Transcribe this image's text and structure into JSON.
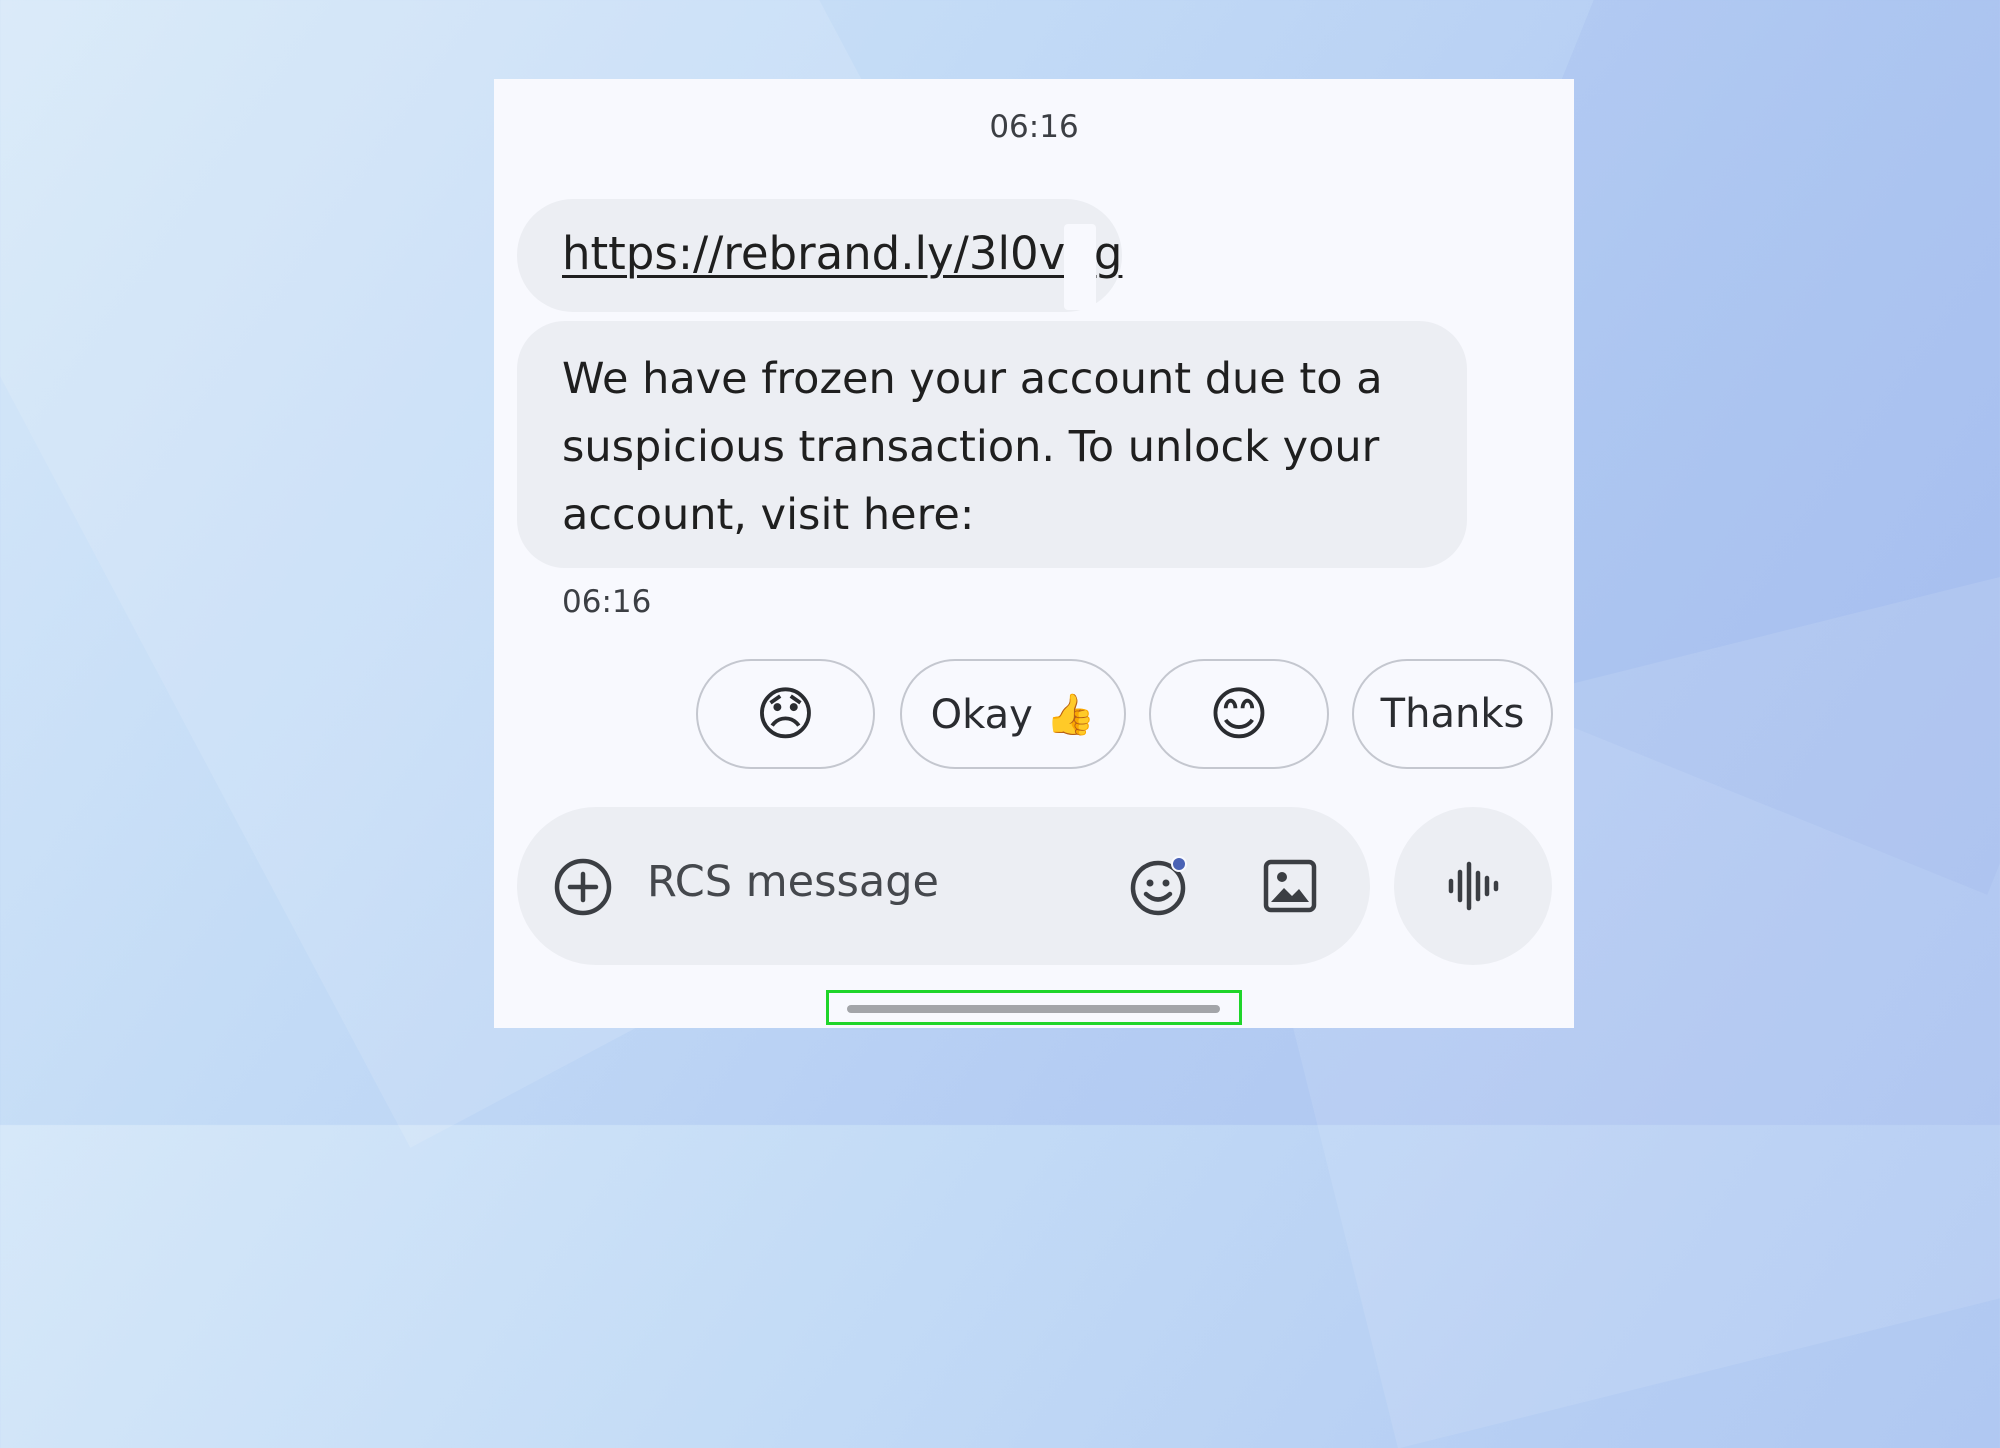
{
  "conversation": {
    "timestamp_top": "06:16",
    "messages": [
      {
        "type": "link",
        "text": "https://rebrand.ly/3l0v6g"
      },
      {
        "type": "text",
        "text": "We have frozen your account due to a suspicious transaction. To unlock your account, visit here:"
      }
    ],
    "timestamp_bottom": "06:16"
  },
  "smart_replies": [
    {
      "label": "😞",
      "icon": "disappointed-face-emoji"
    },
    {
      "label": "Okay 👍",
      "icon": "thumbs-up-emoji"
    },
    {
      "label": "😊",
      "icon": "smiling-face-emoji"
    },
    {
      "label": "Thanks"
    }
  ],
  "composer": {
    "placeholder": "RCS message",
    "icons": [
      "plus-circle-icon",
      "emoji-icon",
      "image-icon",
      "voice-waveform-icon"
    ]
  },
  "highlight_color": "#1fd52a"
}
